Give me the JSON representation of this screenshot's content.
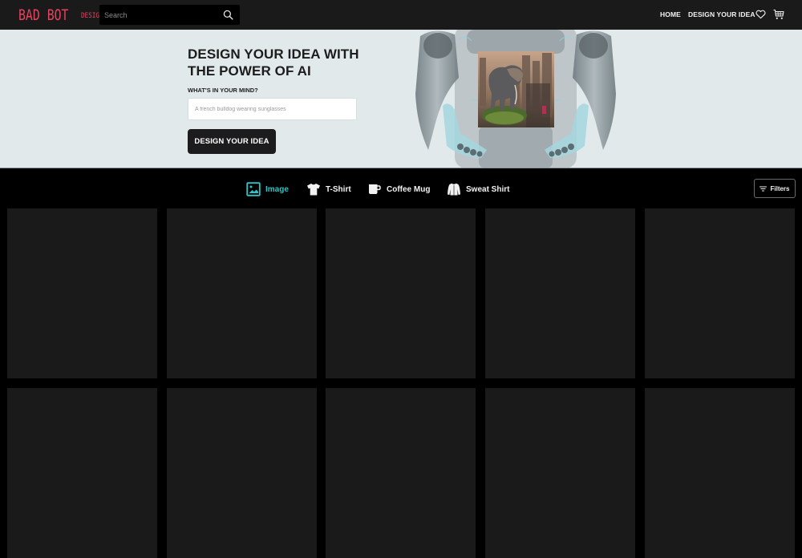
{
  "header": {
    "logo_main": "BAD BOT",
    "logo_sub": "DESIGN",
    "search_placeholder": "Search",
    "nav": [
      {
        "label": "HOME"
      },
      {
        "label": "DESIGN YOUR IDEA"
      }
    ],
    "icons": [
      "search-icon",
      "heart-icon",
      "cart-icon"
    ]
  },
  "hero": {
    "title": "DESIGN YOUR IDEA WITH THE POWER OF AI",
    "prompt_label": "WHAT'S IN YOUR MIND?",
    "prompt_placeholder": "A french bulldog wearing sunglasses",
    "prompt_value": "",
    "button_label": "DESIGN YOUR IDEA",
    "preview_description": "Elephant standing on a grassy rock in a city"
  },
  "categories": {
    "active_index": 0,
    "active_color": "#2bc4c8",
    "items": [
      {
        "label": "Image",
        "icon": "image-icon"
      },
      {
        "label": "T-Shirt",
        "icon": "tshirt-icon"
      },
      {
        "label": "Coffee Mug",
        "icon": "mug-icon"
      },
      {
        "label": "Sweat Shirt",
        "icon": "sweatshirt-icon"
      }
    ],
    "filters_label": "Filters"
  },
  "grid": {
    "placeholder_count": 10
  },
  "colors": {
    "brand": "#e8425e",
    "header_bg": "#1a1a1a",
    "hero_bg": "#e1e9eb",
    "card_bg": "#1a1a1a"
  }
}
